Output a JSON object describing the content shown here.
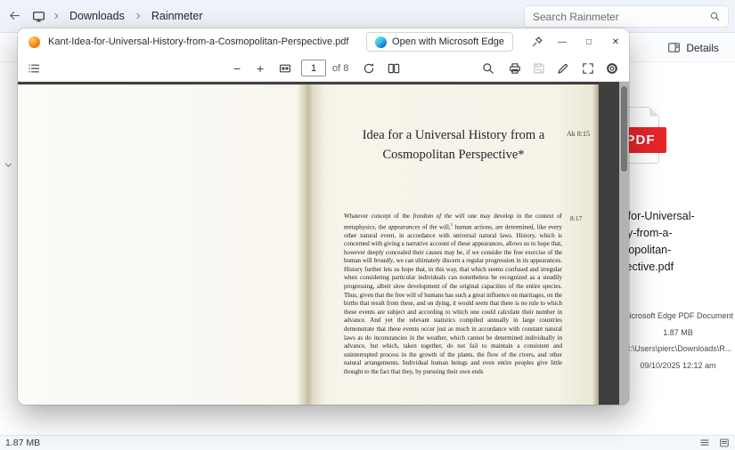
{
  "explorer": {
    "topbar": {
      "breadcrumb_items": [
        "Downloads",
        "Rainmeter"
      ],
      "search_placeholder": "Search Rainmeter"
    },
    "details_toggle_label": "Details",
    "details_pane": {
      "badge": "PDF",
      "name_lines": [
        "Kant-Idea-for-Universal-",
        "History-from-a-",
        "Cosmopolitan-",
        "Perspective.pdf"
      ],
      "type": "Microsoft Edge PDF Document",
      "size": "1.87 MB",
      "path": "C:\\Users\\pierc\\Downloads\\R...",
      "modified": "09/10/2025 12:12 am"
    },
    "statusbar": {
      "size_label": "1.87 MB"
    }
  },
  "pdf_window": {
    "title": "Kant-Idea-for-Universal-History-from-a-Cosmopolitan-Perspective.pdf",
    "open_with_label": "Open with Microsoft Edge",
    "controls": {
      "minimize": "—",
      "maximize": "□",
      "close": "✕"
    },
    "toolbar": {
      "zoom_out": "−",
      "zoom_in": "+",
      "page_value": "1",
      "page_count_label": "of 8"
    },
    "page": {
      "ak_note": "Ak 8:15",
      "margin_note": "8:17",
      "heading_line1": "Idea for a Universal History from a",
      "heading_line2": "Cosmopolitan Perspective*",
      "body_segments": [
        {
          "t": "Whatever concept of the "
        },
        {
          "t": "freedom of the will",
          "i": true
        },
        {
          "t": " one may develop in the context of metaphysics, the "
        },
        {
          "t": "appearances",
          "i": true
        },
        {
          "t": " of the will,"
        },
        {
          "t": "1",
          "sup": true
        },
        {
          "t": " human actions, are determined, like every other natural event, in accordance with universal natural laws. History, which is concerned with giving a narrative account of these appearances, allows us to hope that, however deeply concealed their causes may be, if we consider the free exercise of the human will "
        },
        {
          "t": "broadly",
          "i": true
        },
        {
          "t": ", we can ultimately discern a regular progression in its appearances. History further lets us hope that, in this way, that which seems confused and irregular when considering particular individuals can nonetheless be recognized as a steadily progressing, albeit slow development of the original capacities of the entire species. Thus, given that the free will of humans has such a great influence on marriages, on the births that result from these, and on dying, it would seem that there is no rule to which these events are subject and according to which one could calculate their number in advance. And yet the relevant statistics compiled annually in large countries demonstrate that these events occur just as much in accordance with constant natural laws as do inconstancies in the weather, which cannot be determined individually in advance, but which, taken together, do not fail to maintain a consistent and uninterrupted process in the growth of the plants, the flow of the rivers, and other natural arrangements. Individual human beings and even entire peoples give little thought to the fact that they, by pursuing their own ends"
        }
      ]
    }
  }
}
